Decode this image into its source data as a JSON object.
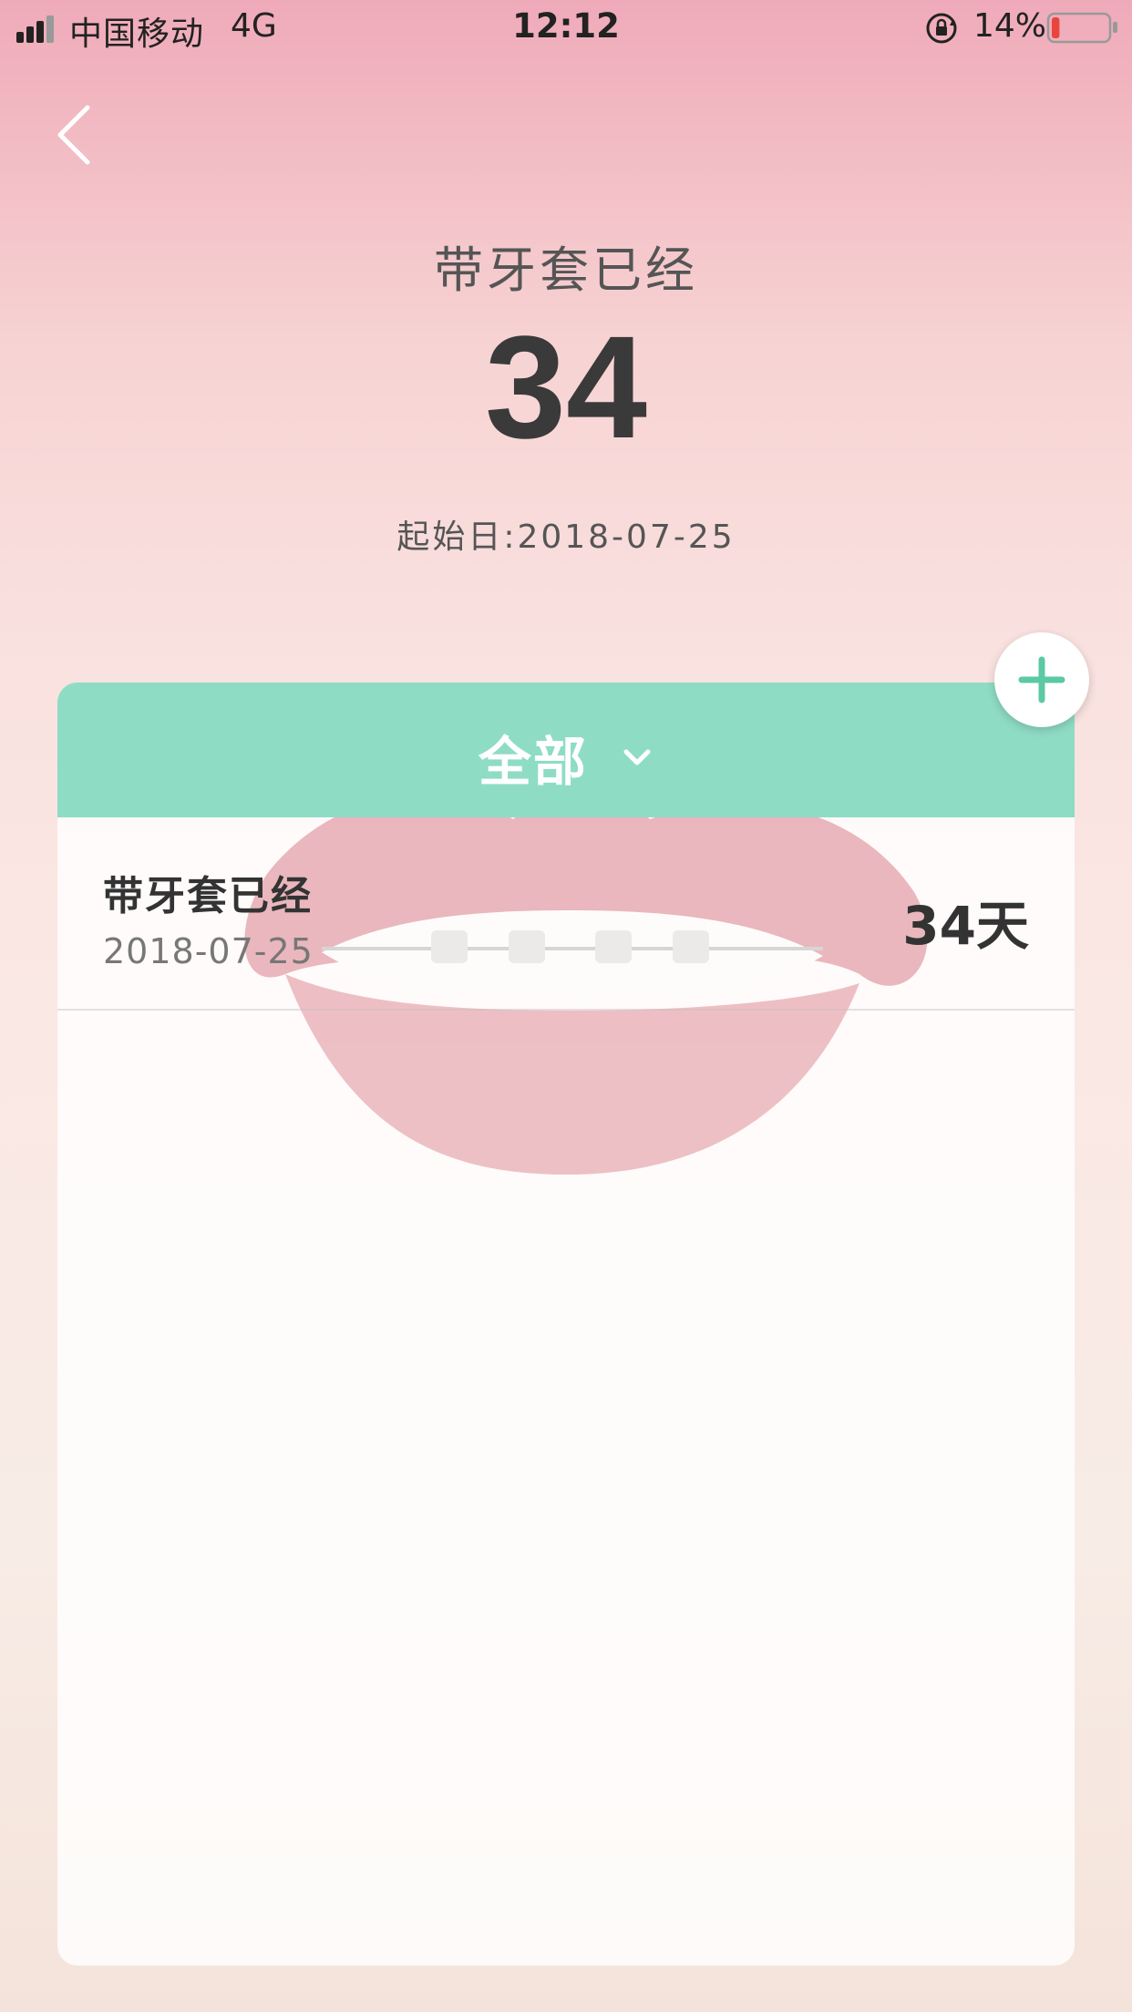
{
  "status_bar": {
    "carrier": "中国移动",
    "network": "4G",
    "time": "12:12",
    "battery": "14%",
    "signal_icon": "signal-bars-icon",
    "lock_icon": "rotation-lock-icon",
    "battery_icon": "battery-low-icon",
    "battery_level": 0.14,
    "battery_color": "#e8453c"
  },
  "nav": {
    "back_icon": "chevron-left-icon"
  },
  "hero": {
    "caption": "带牙套已经",
    "number": "34",
    "start_label": "起始日:2018-07-25"
  },
  "card": {
    "filter_label": "全部",
    "filter_icon": "chevron-down-icon",
    "header_color": "#8fdcc5",
    "items": [
      {
        "title": "带牙套已经",
        "date": "2018-07-25",
        "count": "34天"
      }
    ]
  },
  "add_button": {
    "icon": "plus-icon",
    "color": "#5cc9a5"
  }
}
